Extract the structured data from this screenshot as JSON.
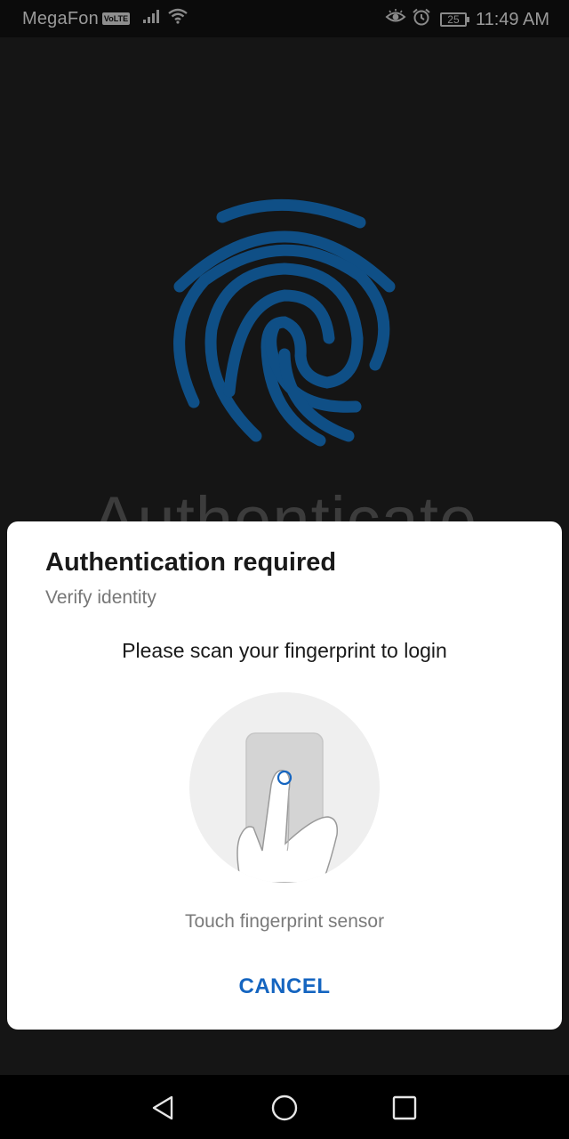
{
  "status_bar": {
    "carrier": "MegaFon",
    "volte_badge": "VoLTE",
    "battery_level": "25",
    "time": "11:49 AM",
    "icons": [
      "signal-icon",
      "wifi-icon",
      "eye-comfort-icon",
      "alarm-icon",
      "battery-icon"
    ]
  },
  "background_app": {
    "heading": "Authenticate",
    "fingerprint_color": "#0f4f86"
  },
  "dialog": {
    "title": "Authentication required",
    "subtitle": "Verify identity",
    "description": "Please scan your fingerprint to login",
    "sensor_hint": "Touch fingerprint sensor",
    "cancel_label": "CANCEL",
    "accent_color": "#1565c0"
  },
  "nav_bar": {
    "buttons": [
      "back-icon",
      "home-icon",
      "recents-icon"
    ]
  }
}
